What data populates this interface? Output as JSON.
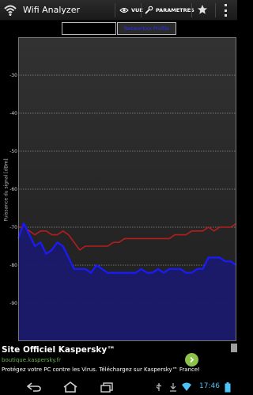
{
  "app": {
    "title": "Wifi Analyzer",
    "icon": "wifi-icon"
  },
  "actionbar": {
    "view_label": "VUE",
    "view_icon": "eye-icon",
    "settings_label": "PARAMETRES",
    "settings_icon": "wrench-icon",
    "favorite_icon": "star-icon",
    "overflow_icon": "overflow-menu-icon"
  },
  "network_selector": {
    "first_value": "",
    "second_value": "Networkxx Profile"
  },
  "chart_data": {
    "type": "line",
    "ylabel": "Puissance du signal [dBm]",
    "ylim": [
      -100,
      -20
    ],
    "yticks": [
      -30,
      -40,
      -50,
      -60,
      -70,
      -80,
      -90
    ],
    "ytick_labels": [
      "-30",
      "-40",
      "-50",
      "-60",
      "-70",
      "-80",
      "-90"
    ],
    "grid": true,
    "x": [
      0,
      1,
      2,
      3,
      4,
      5,
      6,
      7,
      8,
      9,
      10,
      11,
      12,
      13,
      14,
      15,
      16,
      17,
      18,
      19,
      20,
      21,
      22,
      23,
      24,
      25,
      26,
      27,
      28,
      29,
      30,
      31,
      32,
      33,
      34,
      35,
      36,
      37,
      38,
      39
    ],
    "series": [
      {
        "color": "#b71c1c",
        "fill": false,
        "values": [
          -70,
          -70,
          -71,
          -72,
          -71,
          -71,
          -72,
          -72,
          -71,
          -72,
          -74,
          -76,
          -75,
          -75,
          -75,
          -75,
          -75,
          -74,
          -74,
          -73,
          -73,
          -73,
          -73,
          -73,
          -73,
          -73,
          -73,
          -73,
          -72,
          -72,
          -72,
          -71,
          -71,
          -71,
          -70,
          -71,
          -70,
          -70,
          -70,
          -69
        ]
      },
      {
        "color": "#1a1aff",
        "fill": true,
        "fill_color": "#1a1a6e",
        "values": [
          -73,
          -69,
          -72,
          -75,
          -74,
          -77,
          -76,
          -74,
          -75,
          -78,
          -81,
          -81,
          -81,
          -82,
          -80,
          -81,
          -82,
          -82,
          -82,
          -82,
          -82,
          -82,
          -81,
          -82,
          -82,
          -81,
          -82,
          -81,
          -81,
          -81,
          -82,
          -82,
          -81,
          -81,
          -78,
          -78,
          -78,
          -79,
          -79,
          -80
        ]
      }
    ]
  },
  "ad": {
    "title": "Site Officiel Kaspersky™",
    "url": "boutique.kaspersky.fr",
    "description": "Protégez votre PC contre les Virus. Téléchargez sur Kaspersky™ France!",
    "go_icon": "chevron-right-icon"
  },
  "statusbar": {
    "time": "17:46",
    "icons": [
      "usb-icon",
      "download-icon",
      "wifi-signal-icon",
      "battery-icon"
    ]
  },
  "navbar": {
    "back_icon": "back-icon",
    "home_icon": "home-icon",
    "recents_icon": "recents-icon"
  }
}
